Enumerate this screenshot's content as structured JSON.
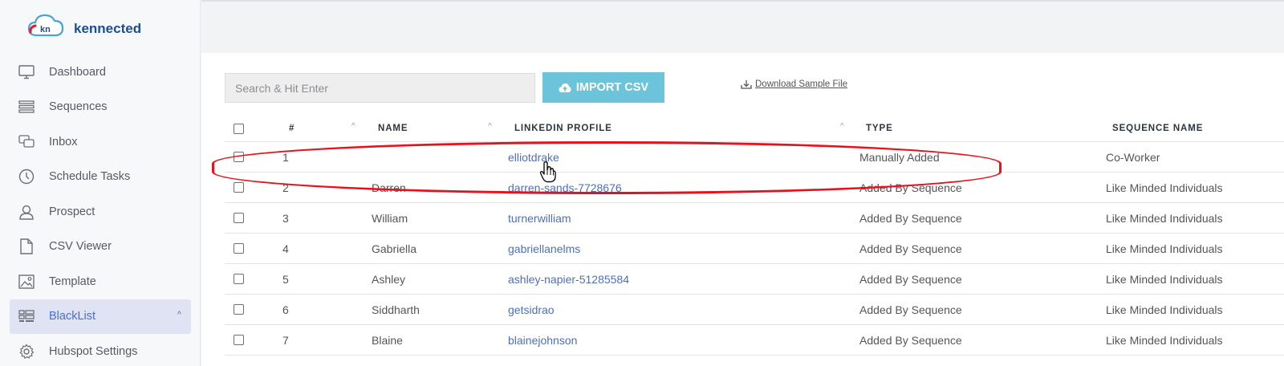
{
  "brand": {
    "logo_mark": "kn",
    "name": "kennected"
  },
  "sidebar": {
    "items": [
      {
        "label": "Dashboard",
        "icon": "monitor-icon"
      },
      {
        "label": "Sequences",
        "icon": "list-icon"
      },
      {
        "label": "Inbox",
        "icon": "chat-icon"
      },
      {
        "label": "Schedule Tasks",
        "icon": "clock-icon"
      },
      {
        "label": "Prospect",
        "icon": "user-icon"
      },
      {
        "label": "CSV Viewer",
        "icon": "file-icon"
      },
      {
        "label": "Template",
        "icon": "image-icon"
      },
      {
        "label": "BlackList",
        "icon": "blacklist-icon",
        "active": true,
        "caret": "^"
      },
      {
        "label": "Hubspot Settings",
        "icon": "gear-icon"
      }
    ]
  },
  "toolbar": {
    "search_placeholder": "Search & Hit Enter",
    "import_label": "IMPORT CSV",
    "download_label": "Download Sample File"
  },
  "table": {
    "columns": {
      "num": "#",
      "name": "NAME",
      "linkedin": "LINKEDIN PROFILE",
      "type": "TYPE",
      "sequence": "SEQUENCE NAME"
    },
    "rows": [
      {
        "num": "1",
        "name": "",
        "linkedin": "elliotdrake",
        "type": "Manually Added",
        "sequence": "Co-Worker"
      },
      {
        "num": "2",
        "name": "Darren",
        "linkedin": "darren-sands-7728676",
        "type": "Added By Sequence",
        "sequence": "Like Minded Individuals"
      },
      {
        "num": "3",
        "name": "William",
        "linkedin": "turnerwilliam",
        "type": "Added By Sequence",
        "sequence": "Like Minded Individuals"
      },
      {
        "num": "4",
        "name": "Gabriella",
        "linkedin": "gabriellanelms",
        "type": "Added By Sequence",
        "sequence": "Like Minded Individuals"
      },
      {
        "num": "5",
        "name": "Ashley",
        "linkedin": "ashley-napier-51285584",
        "type": "Added By Sequence",
        "sequence": "Like Minded Individuals"
      },
      {
        "num": "6",
        "name": "Siddharth",
        "linkedin": "getsidrao",
        "type": "Added By Sequence",
        "sequence": "Like Minded Individuals"
      },
      {
        "num": "7",
        "name": "Blaine",
        "linkedin": "blainejohnson",
        "type": "Added By Sequence",
        "sequence": "Like Minded Individuals"
      }
    ]
  },
  "colors": {
    "accent": "#6cc4da",
    "link": "#4f6fb8",
    "highlight": "#e8101b",
    "active_nav_bg": "#dfe3f3"
  }
}
